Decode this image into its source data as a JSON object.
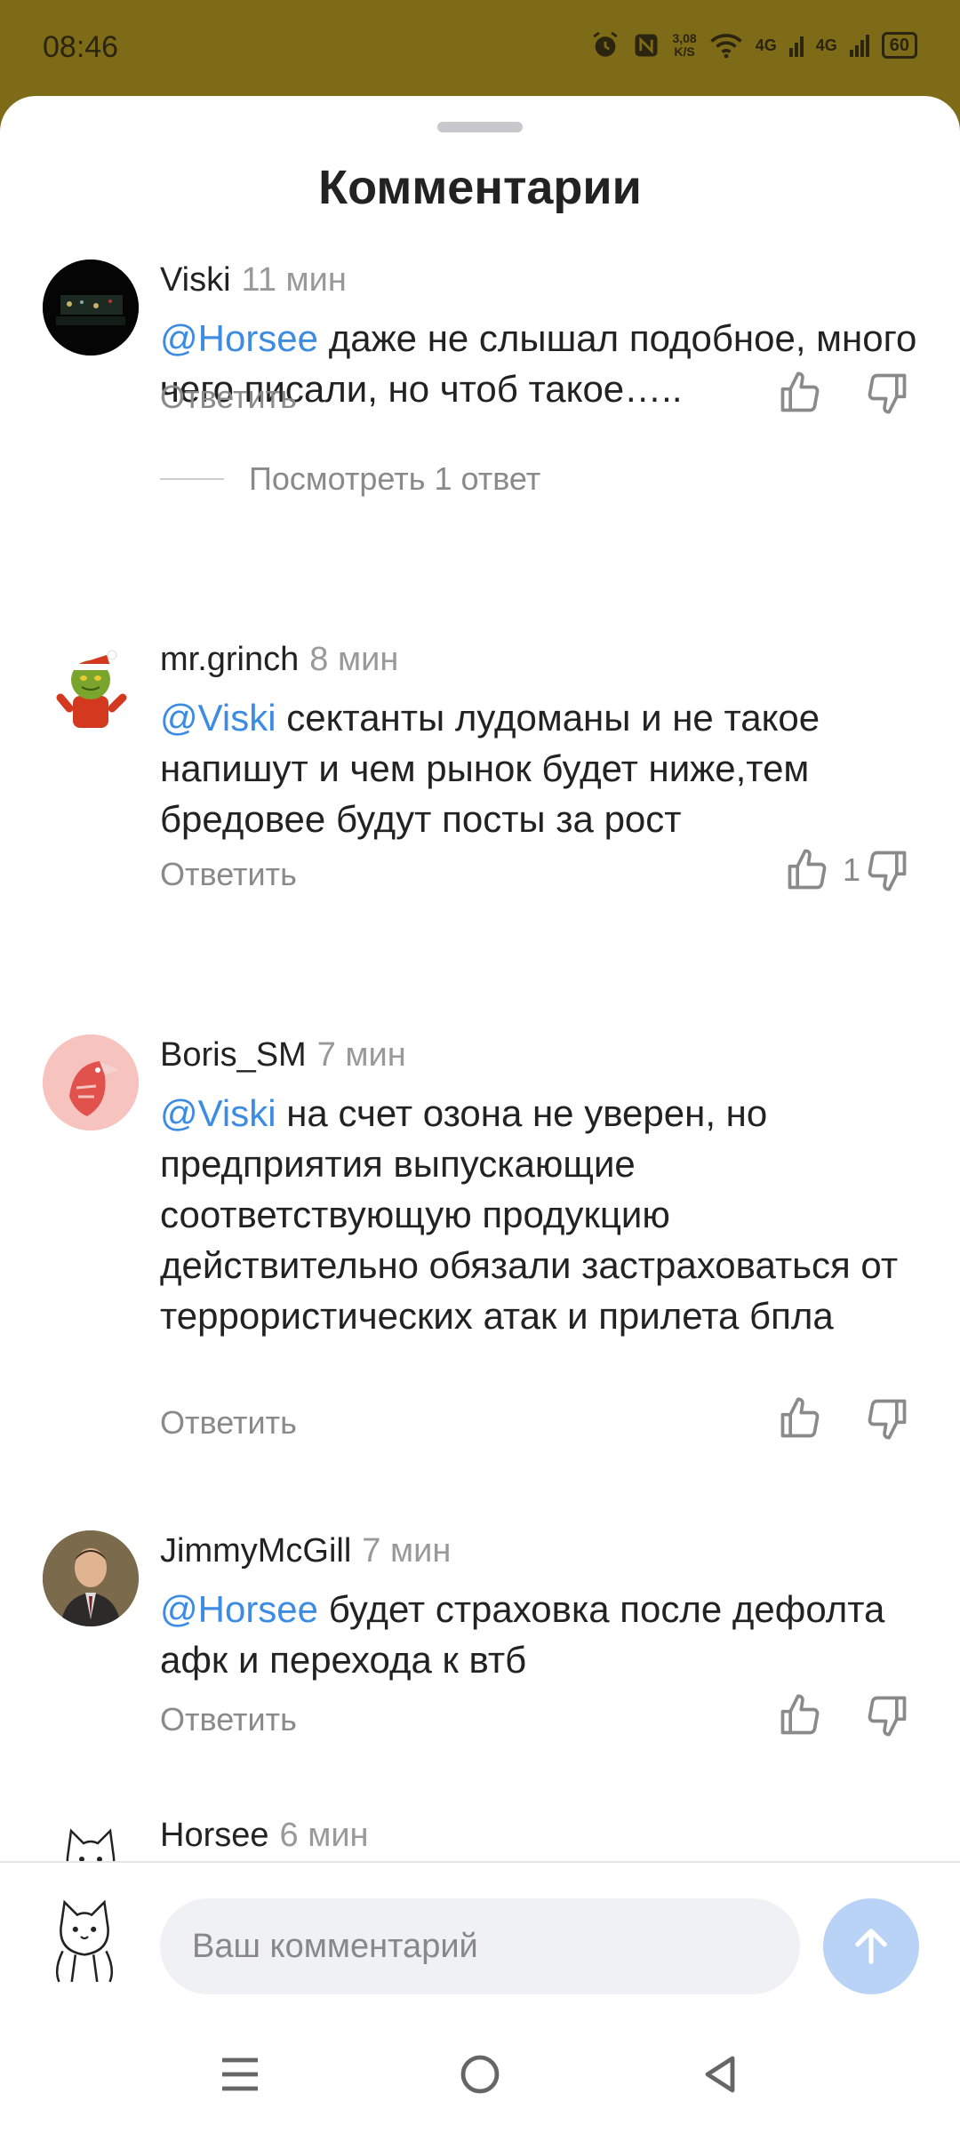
{
  "status_bar": {
    "time": "08:46",
    "speed_value": "3,08",
    "speed_unit": "K/S",
    "net1": "4G",
    "net2": "4G",
    "battery": "60"
  },
  "sheet": {
    "title": "Комментарии"
  },
  "comments": [
    {
      "author": "Viski",
      "time": "11 мин",
      "mention": "@Horsee",
      "text": " даже не слышал подобное, много чего писали, но чтоб такое…..",
      "reply_label": "Ответить",
      "likes": "",
      "show_replies": "Посмотреть 1 ответ"
    },
    {
      "author": "mr.grinch",
      "time": "8 мин",
      "mention": "@Viski",
      "text": " сектанты лудоманы и не такое напишут и чем рынок будет ниже,тем бредовее будут посты за рост",
      "reply_label": "Ответить",
      "likes": "1"
    },
    {
      "author": "Boris_SM",
      "time": "7 мин",
      "mention": "@Viski",
      "text": " на счет озона не уверен, но предприятия выпускающие соответствующую продукцию действительно обязали застраховаться от террористических атак и прилета бпла",
      "reply_label": "Ответить",
      "likes": ""
    },
    {
      "author": "JimmyMcGill",
      "time": "7 мин",
      "mention": "@Horsee",
      "text": " будет страховка после дефолта афк и перехода к втб",
      "reply_label": "Ответить",
      "likes": ""
    },
    {
      "author": "Horsee",
      "time": "6 мин"
    }
  ],
  "input": {
    "placeholder": "Ваш комментарий"
  },
  "colors": {
    "status_bg": "#7d6b17",
    "mention": "#3c8ce3",
    "send_button": "#b9d3f7"
  },
  "icons": {
    "like": "thumbs-up-icon",
    "dislike": "thumbs-down-icon",
    "send": "arrow-up-icon",
    "nav_menu": "menu-icon",
    "nav_home": "home-circle-icon",
    "nav_back": "back-triangle-icon"
  }
}
